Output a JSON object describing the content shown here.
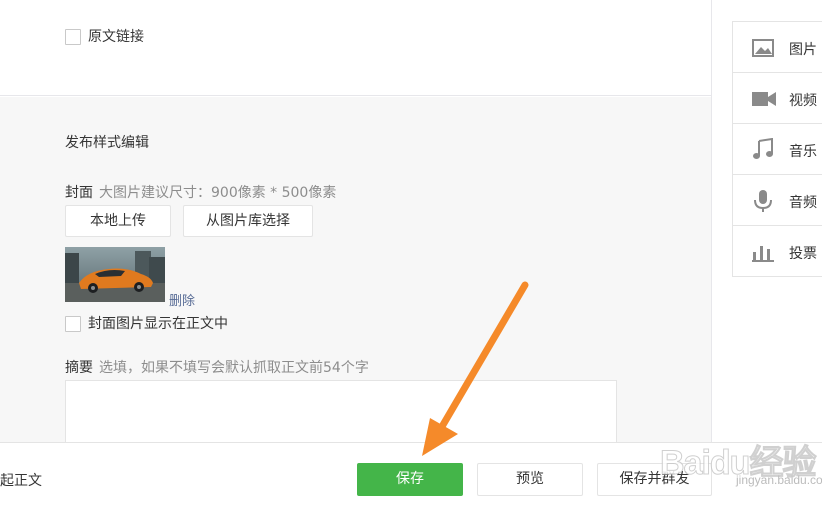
{
  "original_link": {
    "label": "原文链接"
  },
  "publish_style": {
    "title": "发布样式编辑",
    "cover": {
      "label": "封面",
      "hint": "大图片建议尺寸：900像素 * 500像素",
      "local_upload_label": "本地上传",
      "library_select_label": "从图片库选择",
      "delete_label": "删除",
      "show_in_body_label": "封面图片显示在正文中"
    },
    "summary": {
      "label": "摘要",
      "hint": "选填，如果不填写会默认抓取正文前54个字",
      "value": ""
    }
  },
  "bottom_bar": {
    "fold_label": "收起正文",
    "save_label": "保存",
    "preview_label": "预览",
    "save_mass_label": "保存并群发"
  },
  "insert_panel": {
    "items": [
      {
        "label": "图片",
        "icon": "image-icon"
      },
      {
        "label": "视频",
        "icon": "video-icon"
      },
      {
        "label": "音乐",
        "icon": "music-icon"
      },
      {
        "label": "音频",
        "icon": "microphone-icon"
      },
      {
        "label": "投票",
        "icon": "poll-icon"
      }
    ]
  },
  "watermark": {
    "brand": "Baidu经验",
    "sub": "jingyan.baidu.com"
  },
  "colors": {
    "accent_green": "#44b549",
    "link_blue": "#576b95",
    "arrow_orange": "#f58a2a",
    "panel_bg": "#f7f7f7",
    "border": "#e4e4e4"
  }
}
